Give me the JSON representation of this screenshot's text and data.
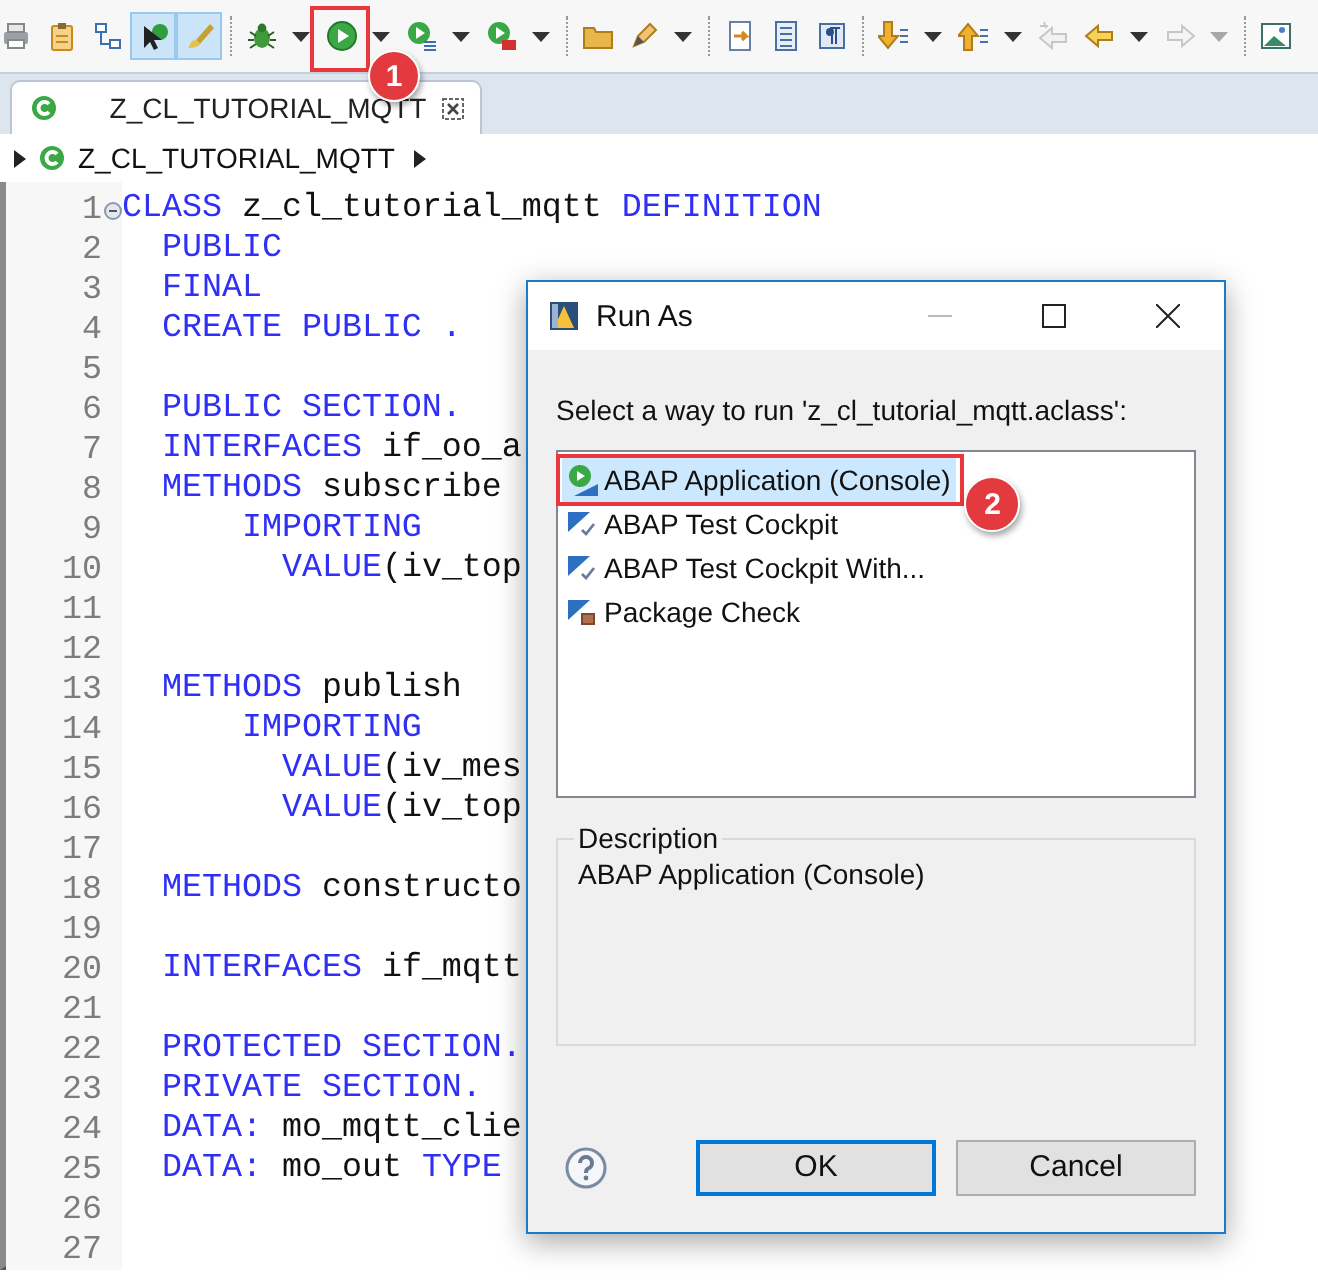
{
  "toolbar": [
    {
      "kind": "printer",
      "pressed": false,
      "disabled": false
    },
    {
      "kind": "clipboard",
      "pressed": false,
      "disabled": false
    },
    {
      "kind": "hierarchy",
      "pressed": false,
      "disabled": false
    },
    {
      "kind": "cursor",
      "pressed": true,
      "disabled": false
    },
    {
      "kind": "brush",
      "pressed": true,
      "disabled": false
    },
    {
      "kind": "separator"
    },
    {
      "kind": "bug",
      "pressed": false,
      "disabled": false
    },
    {
      "kind": "dropdown",
      "pressed": false,
      "disabled": false
    },
    {
      "kind": "run",
      "pressed": false,
      "disabled": false,
      "callout": "1"
    },
    {
      "kind": "dropdown",
      "pressed": false,
      "disabled": false
    },
    {
      "kind": "run-list",
      "pressed": false,
      "disabled": false
    },
    {
      "kind": "dropdown",
      "pressed": false,
      "disabled": false
    },
    {
      "kind": "run-toolbox",
      "pressed": false,
      "disabled": false
    },
    {
      "kind": "dropdown",
      "pressed": false,
      "disabled": false
    },
    {
      "kind": "separator"
    },
    {
      "kind": "folder",
      "pressed": false,
      "disabled": false
    },
    {
      "kind": "pen",
      "pressed": false,
      "disabled": false
    },
    {
      "kind": "dropdown",
      "pressed": false,
      "disabled": false
    },
    {
      "kind": "separator"
    },
    {
      "kind": "document-arrow",
      "pressed": false,
      "disabled": false
    },
    {
      "kind": "document",
      "pressed": false,
      "disabled": false
    },
    {
      "kind": "paragraph",
      "pressed": false,
      "disabled": false
    },
    {
      "kind": "separator"
    },
    {
      "kind": "next-down",
      "pressed": false,
      "disabled": false
    },
    {
      "kind": "dropdown",
      "pressed": false,
      "disabled": false
    },
    {
      "kind": "next-up",
      "pressed": false,
      "disabled": false
    },
    {
      "kind": "dropdown",
      "pressed": false,
      "disabled": false
    },
    {
      "kind": "back-edit",
      "pressed": false,
      "disabled": true
    },
    {
      "kind": "back",
      "pressed": false,
      "disabled": false
    },
    {
      "kind": "dropdown",
      "pressed": false,
      "disabled": false
    },
    {
      "kind": "forward",
      "pressed": false,
      "disabled": true
    },
    {
      "kind": "dropdown",
      "pressed": false,
      "disabled": true
    },
    {
      "kind": "separator"
    },
    {
      "kind": "image",
      "pressed": false,
      "disabled": false
    }
  ],
  "tabs": [
    {
      "label": "Z_CL_TUTORIAL_MQTT",
      "selected": true
    }
  ],
  "breadcrumb": {
    "label": "Z_CL_TUTORIAL_MQTT"
  },
  "editor": {
    "lines": [
      {
        "number": "1",
        "fold_marker": true,
        "tokens": [
          {
            "kind": "keyword",
            "text": "CLASS"
          },
          {
            "kind": "plain",
            "text": " z_cl_tutorial_mqtt "
          },
          {
            "kind": "keyword",
            "text": "DEFINITION"
          }
        ]
      },
      {
        "number": "2",
        "tokens": [
          {
            "kind": "keyword",
            "text": "  PUBLIC"
          }
        ]
      },
      {
        "number": "3",
        "tokens": [
          {
            "kind": "keyword",
            "text": "  FINAL"
          }
        ]
      },
      {
        "number": "4",
        "tokens": [
          {
            "kind": "keyword",
            "text": "  CREATE PUBLIC ."
          }
        ]
      },
      {
        "number": "5"
      },
      {
        "number": "6",
        "tokens": [
          {
            "kind": "keyword",
            "text": "  PUBLIC SECTION."
          }
        ]
      },
      {
        "number": "7",
        "tokens": [
          {
            "kind": "keyword",
            "text": "  INTERFACES"
          },
          {
            "kind": "plain",
            "text": " if_oo_a"
          }
        ]
      },
      {
        "number": "8",
        "tokens": [
          {
            "kind": "keyword",
            "text": "  METHODS"
          },
          {
            "kind": "plain",
            "text": " subscribe"
          }
        ]
      },
      {
        "number": "9",
        "tokens": [
          {
            "kind": "keyword",
            "text": "      IMPORTING"
          }
        ]
      },
      {
        "number": "10",
        "tokens": [
          {
            "kind": "keyword",
            "text": "        VALUE"
          },
          {
            "kind": "plain",
            "text": "(iv_top"
          }
        ]
      },
      {
        "number": "11"
      },
      {
        "number": "12"
      },
      {
        "number": "13",
        "tokens": [
          {
            "kind": "keyword",
            "text": "  METHODS"
          },
          {
            "kind": "plain",
            "text": " publish"
          }
        ]
      },
      {
        "number": "14",
        "tokens": [
          {
            "kind": "keyword",
            "text": "      IMPORTING"
          }
        ]
      },
      {
        "number": "15",
        "tokens": [
          {
            "kind": "keyword",
            "text": "        VALUE"
          },
          {
            "kind": "plain",
            "text": "(iv_mes"
          }
        ]
      },
      {
        "number": "16",
        "tokens": [
          {
            "kind": "keyword",
            "text": "        VALUE"
          },
          {
            "kind": "plain",
            "text": "(iv_top"
          }
        ]
      },
      {
        "number": "17"
      },
      {
        "number": "18",
        "tokens": [
          {
            "kind": "keyword",
            "text": "  METHODS"
          },
          {
            "kind": "plain",
            "text": " constructo"
          }
        ]
      },
      {
        "number": "19"
      },
      {
        "number": "20",
        "tokens": [
          {
            "kind": "keyword",
            "text": "  INTERFACES"
          },
          {
            "kind": "plain",
            "text": " if_mqtt"
          }
        ]
      },
      {
        "number": "21"
      },
      {
        "number": "22",
        "tokens": [
          {
            "kind": "keyword",
            "text": "  PROTECTED SECTION."
          }
        ]
      },
      {
        "number": "23",
        "tokens": [
          {
            "kind": "keyword",
            "text": "  PRIVATE SECTION."
          }
        ]
      },
      {
        "number": "24",
        "tokens": [
          {
            "kind": "keyword",
            "text": "  DATA:"
          },
          {
            "kind": "plain",
            "text": " mo_mqtt_clie"
          }
        ]
      },
      {
        "number": "25",
        "tokens": [
          {
            "kind": "keyword",
            "text": "  DATA:"
          },
          {
            "kind": "plain",
            "text": " mo_out "
          },
          {
            "kind": "keyword",
            "text": "TYPE"
          }
        ]
      },
      {
        "number": "26"
      },
      {
        "number": "27"
      }
    ]
  },
  "dialog": {
    "title": "Run As",
    "prompt": "Select a way to run 'z_cl_tutorial_mqtt.aclass':",
    "options": [
      {
        "kind": "application",
        "label": "ABAP Application (Console)",
        "selected": true,
        "callout": "2"
      },
      {
        "kind": "test-cockpit",
        "label": "ABAP Test Cockpit",
        "selected": false
      },
      {
        "kind": "test-cockpit",
        "label": "ABAP Test Cockpit With...",
        "selected": false
      },
      {
        "kind": "package-check",
        "label": "Package Check",
        "selected": false
      }
    ],
    "description": {
      "legend": "Description",
      "text": "ABAP Application (Console)"
    },
    "buttons": [
      {
        "label": "OK",
        "default": true
      },
      {
        "label": "Cancel",
        "default": false
      }
    ]
  }
}
